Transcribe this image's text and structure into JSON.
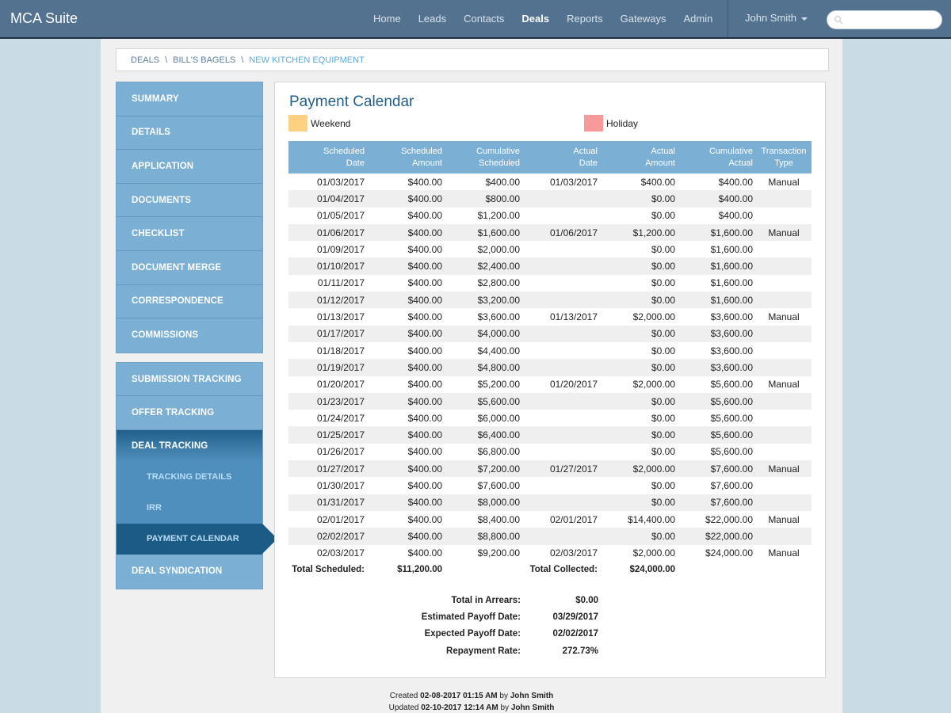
{
  "app": {
    "title": "MCA Suite"
  },
  "nav": {
    "links": [
      {
        "label": "Home",
        "active": false
      },
      {
        "label": "Leads",
        "active": false
      },
      {
        "label": "Contacts",
        "active": false
      },
      {
        "label": "Deals",
        "active": true
      },
      {
        "label": "Reports",
        "active": false
      },
      {
        "label": "Gateways",
        "active": false
      },
      {
        "label": "Admin",
        "active": false
      }
    ],
    "user": "John Smith",
    "search_placeholder": ""
  },
  "breadcrumb": [
    "DEALS",
    "BILL'S BAGELS",
    "NEW KITCHEN EQUIPMENT"
  ],
  "breadcrumb_separator": "\\",
  "sidebar": {
    "group1": [
      "SUMMARY",
      "DETAILS",
      "APPLICATION",
      "DOCUMENTS",
      "CHECKLIST",
      "DOCUMENT MERGE",
      "CORRESPONDENCE",
      "COMMISSIONS"
    ],
    "group2": {
      "submission_tracking": "SUBMISSION TRACKING",
      "offer_tracking": "OFFER TRACKING",
      "deal_tracking": "DEAL TRACKING",
      "sub_items": [
        "TRACKING DETAILS",
        "IRR",
        "PAYMENT CALENDAR"
      ],
      "active_sub_item": "PAYMENT CALENDAR",
      "deal_syndication": "DEAL SYNDICATION"
    }
  },
  "main": {
    "title": "Payment Calendar",
    "legend": {
      "weekend": {
        "label": "Weekend",
        "color": "#fdd17f"
      },
      "holiday": {
        "label": "Holiday",
        "color": "#f99a9a"
      }
    },
    "table": {
      "headers": [
        [
          "Scheduled",
          "Date"
        ],
        [
          "Scheduled",
          "Amount"
        ],
        [
          "Cumulative",
          "Scheduled"
        ],
        [
          "Actual",
          "Date"
        ],
        [
          "Actual",
          "Amount"
        ],
        [
          "Cumulative",
          "Actual"
        ],
        [
          "Transaction",
          "Type"
        ]
      ],
      "rows": [
        [
          "01/03/2017",
          "$400.00",
          "$400.00",
          "01/03/2017",
          "$400.00",
          "$400.00",
          "Manual"
        ],
        [
          "01/04/2017",
          "$400.00",
          "$800.00",
          "",
          "$0.00",
          "$400.00",
          ""
        ],
        [
          "01/05/2017",
          "$400.00",
          "$1,200.00",
          "",
          "$0.00",
          "$400.00",
          ""
        ],
        [
          "01/06/2017",
          "$400.00",
          "$1,600.00",
          "01/06/2017",
          "$1,200.00",
          "$1,600.00",
          "Manual"
        ],
        [
          "01/09/2017",
          "$400.00",
          "$2,000.00",
          "",
          "$0.00",
          "$1,600.00",
          ""
        ],
        [
          "01/10/2017",
          "$400.00",
          "$2,400.00",
          "",
          "$0.00",
          "$1,600.00",
          ""
        ],
        [
          "01/11/2017",
          "$400.00",
          "$2,800.00",
          "",
          "$0.00",
          "$1,600.00",
          ""
        ],
        [
          "01/12/2017",
          "$400.00",
          "$3,200.00",
          "",
          "$0.00",
          "$1,600.00",
          ""
        ],
        [
          "01/13/2017",
          "$400.00",
          "$3,600.00",
          "01/13/2017",
          "$2,000.00",
          "$3,600.00",
          "Manual"
        ],
        [
          "01/17/2017",
          "$400.00",
          "$4,000.00",
          "",
          "$0.00",
          "$3,600.00",
          ""
        ],
        [
          "01/18/2017",
          "$400.00",
          "$4,400.00",
          "",
          "$0.00",
          "$3,600.00",
          ""
        ],
        [
          "01/19/2017",
          "$400.00",
          "$4,800.00",
          "",
          "$0.00",
          "$3,600.00",
          ""
        ],
        [
          "01/20/2017",
          "$400.00",
          "$5,200.00",
          "01/20/2017",
          "$2,000.00",
          "$5,600.00",
          "Manual"
        ],
        [
          "01/23/2017",
          "$400.00",
          "$5,600.00",
          "",
          "$0.00",
          "$5,600.00",
          ""
        ],
        [
          "01/24/2017",
          "$400.00",
          "$6,000.00",
          "",
          "$0.00",
          "$5,600.00",
          ""
        ],
        [
          "01/25/2017",
          "$400.00",
          "$6,400.00",
          "",
          "$0.00",
          "$5,600.00",
          ""
        ],
        [
          "01/26/2017",
          "$400.00",
          "$6,800.00",
          "",
          "$0.00",
          "$5,600.00",
          ""
        ],
        [
          "01/27/2017",
          "$400.00",
          "$7,200.00",
          "01/27/2017",
          "$2,000.00",
          "$7,600.00",
          "Manual"
        ],
        [
          "01/30/2017",
          "$400.00",
          "$7,600.00",
          "",
          "$0.00",
          "$7,600.00",
          ""
        ],
        [
          "01/31/2017",
          "$400.00",
          "$8,000.00",
          "",
          "$0.00",
          "$7,600.00",
          ""
        ],
        [
          "02/01/2017",
          "$400.00",
          "$8,400.00",
          "02/01/2017",
          "$14,400.00",
          "$22,000.00",
          "Manual"
        ],
        [
          "02/02/2017",
          "$400.00",
          "$8,800.00",
          "",
          "$0.00",
          "$22,000.00",
          ""
        ],
        [
          "02/03/2017",
          "$400.00",
          "$9,200.00",
          "02/03/2017",
          "$2,000.00",
          "$24,000.00",
          "Manual"
        ]
      ],
      "totals": {
        "scheduled_label": "Total Scheduled:",
        "scheduled_value": "$11,200.00",
        "collected_label": "Total Collected:",
        "collected_value": "$24,000.00"
      }
    },
    "summary": [
      {
        "label": "Total in Arrears:",
        "value": "$0.00"
      },
      {
        "label": "Estimated Payoff Date:",
        "value": "03/29/2017"
      },
      {
        "label": "Expected Payoff Date:",
        "value": "02/02/2017"
      },
      {
        "label": "Repayment Rate:",
        "value": "272.73%"
      }
    ]
  },
  "footer": {
    "created_prefix": "Created",
    "created_at": "02-08-2017 01:15 AM",
    "created_by_prefix": "by",
    "created_by": "John Smith",
    "updated_prefix": "Updated",
    "updated_at": "02-10-2017 12:14 AM",
    "updated_by_prefix": "by",
    "updated_by": "John Smith"
  }
}
